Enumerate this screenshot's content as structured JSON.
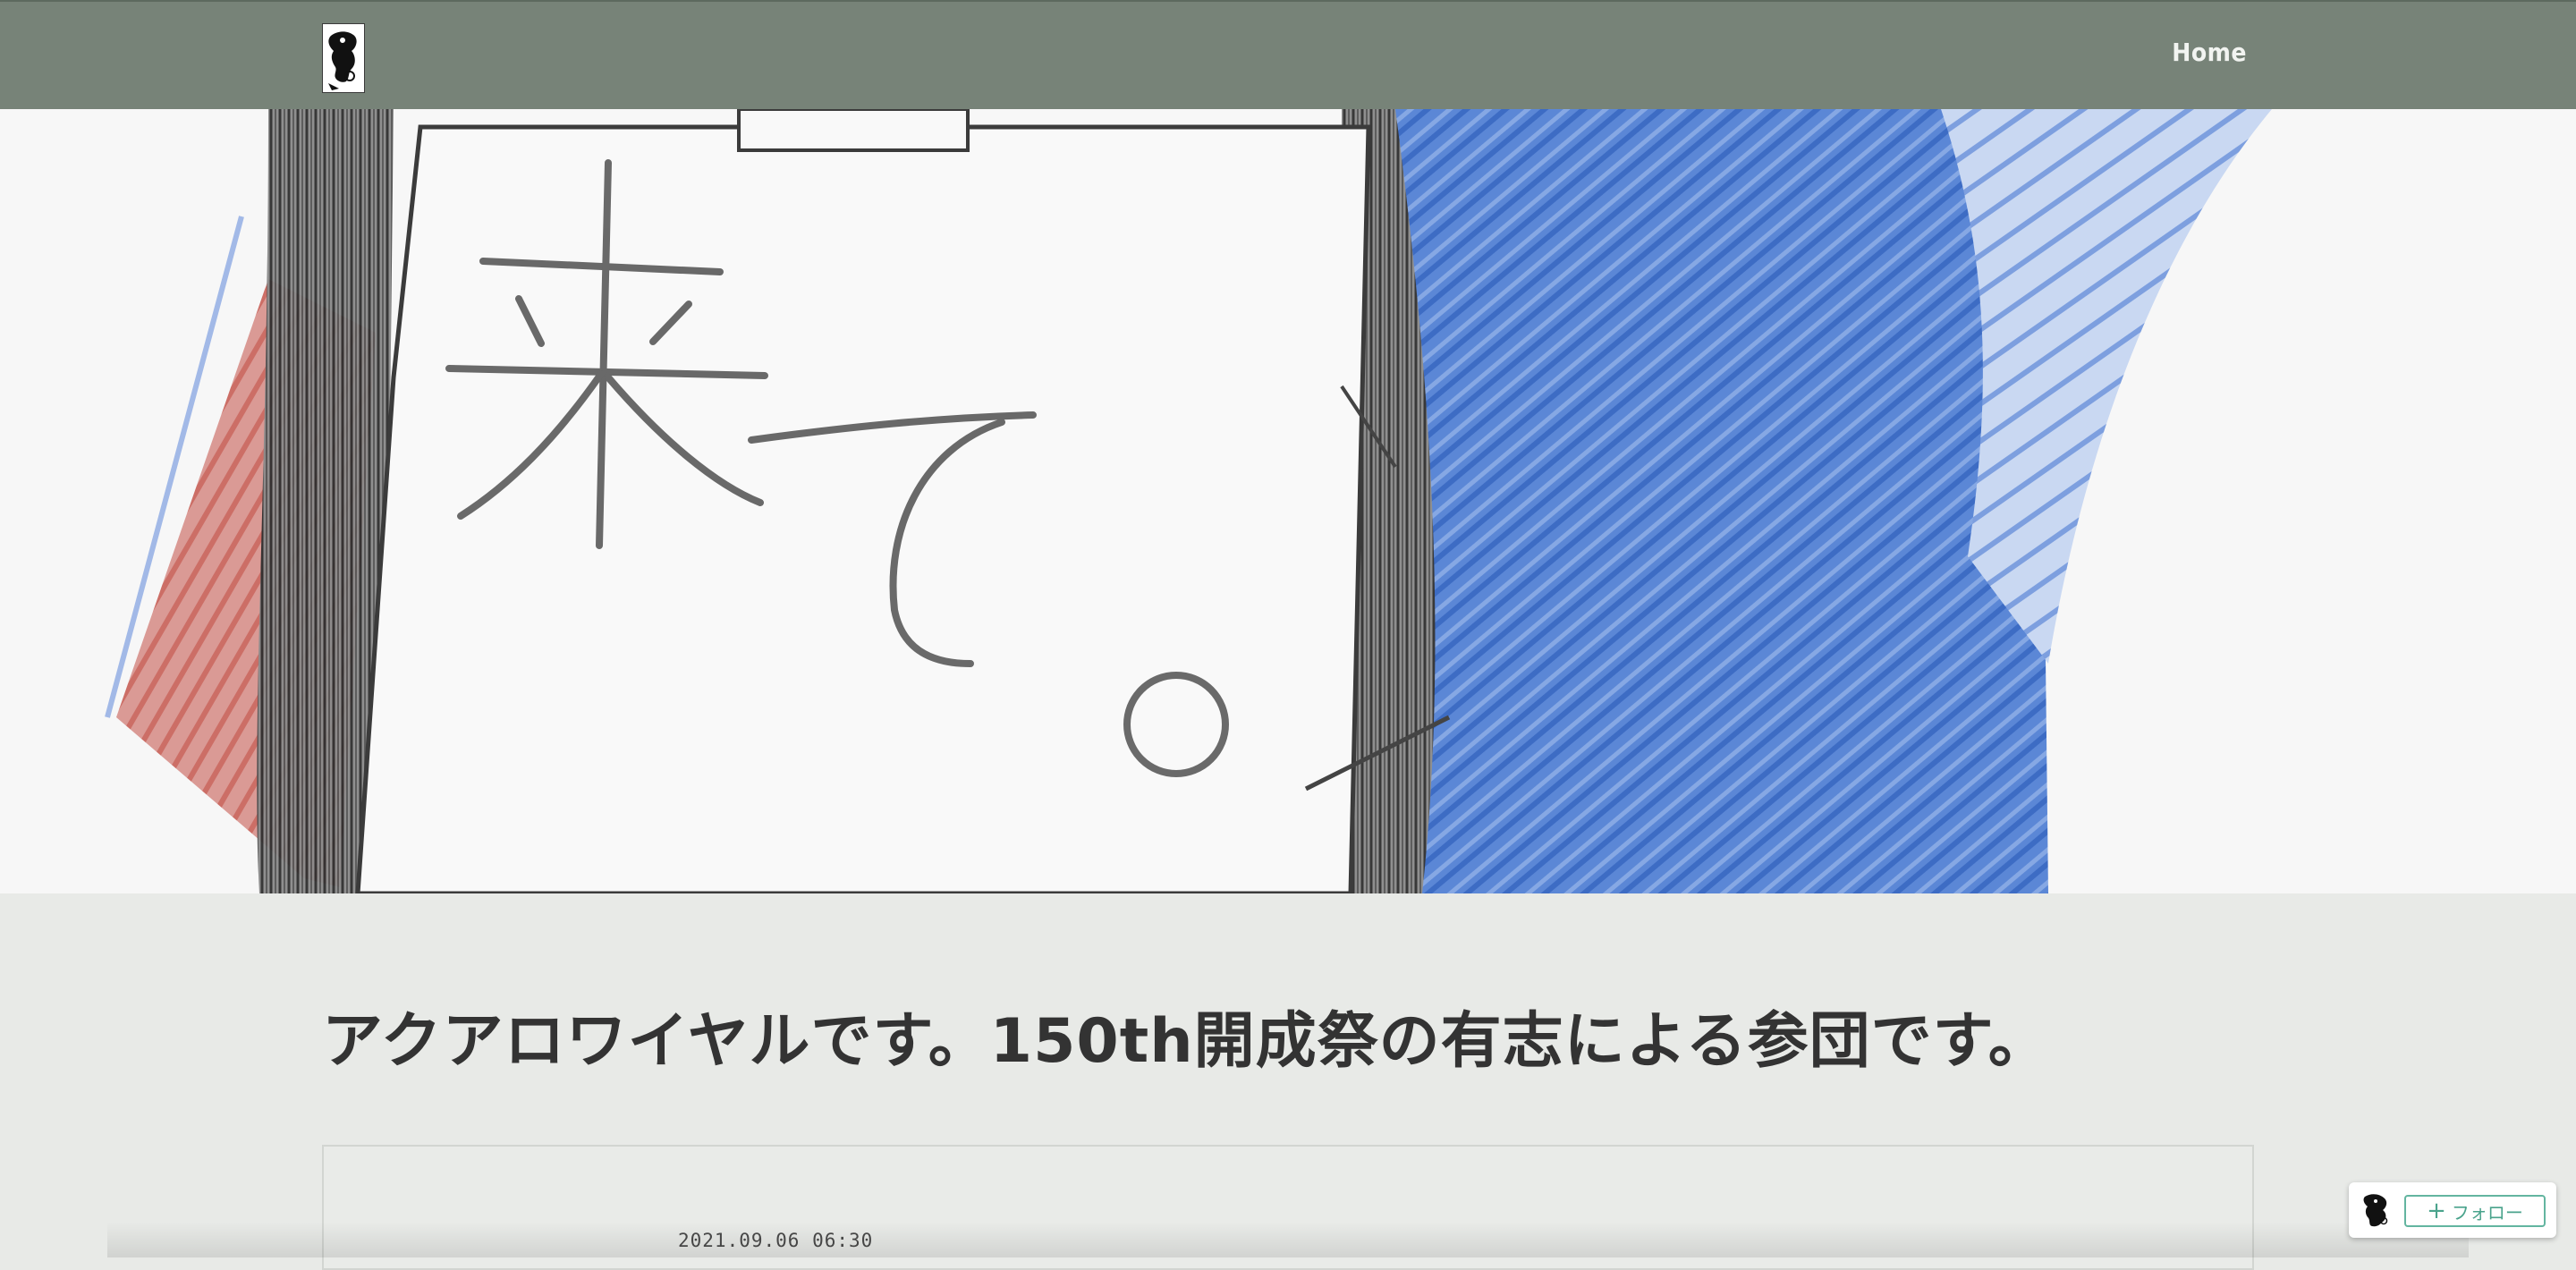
{
  "header": {
    "logo_icon": "shachi-logo-icon",
    "nav": [
      {
        "label": "Home"
      }
    ],
    "background": "#778378"
  },
  "hero": {
    "image": "crayon-drawing",
    "sign_text": "来て。",
    "colors": {
      "blue": "#4a7bd0",
      "red": "#cc5d55",
      "pencil": "#3a3a3a"
    }
  },
  "article": {
    "title": "アクアロワイヤルです。150th開成祭の有志による参団です。",
    "date": "2021.09.06 06:30"
  },
  "follow_widget": {
    "avatar_icon": "shachi-avatar-icon",
    "button_label": "フォロー",
    "accent": "#63b5a0"
  }
}
